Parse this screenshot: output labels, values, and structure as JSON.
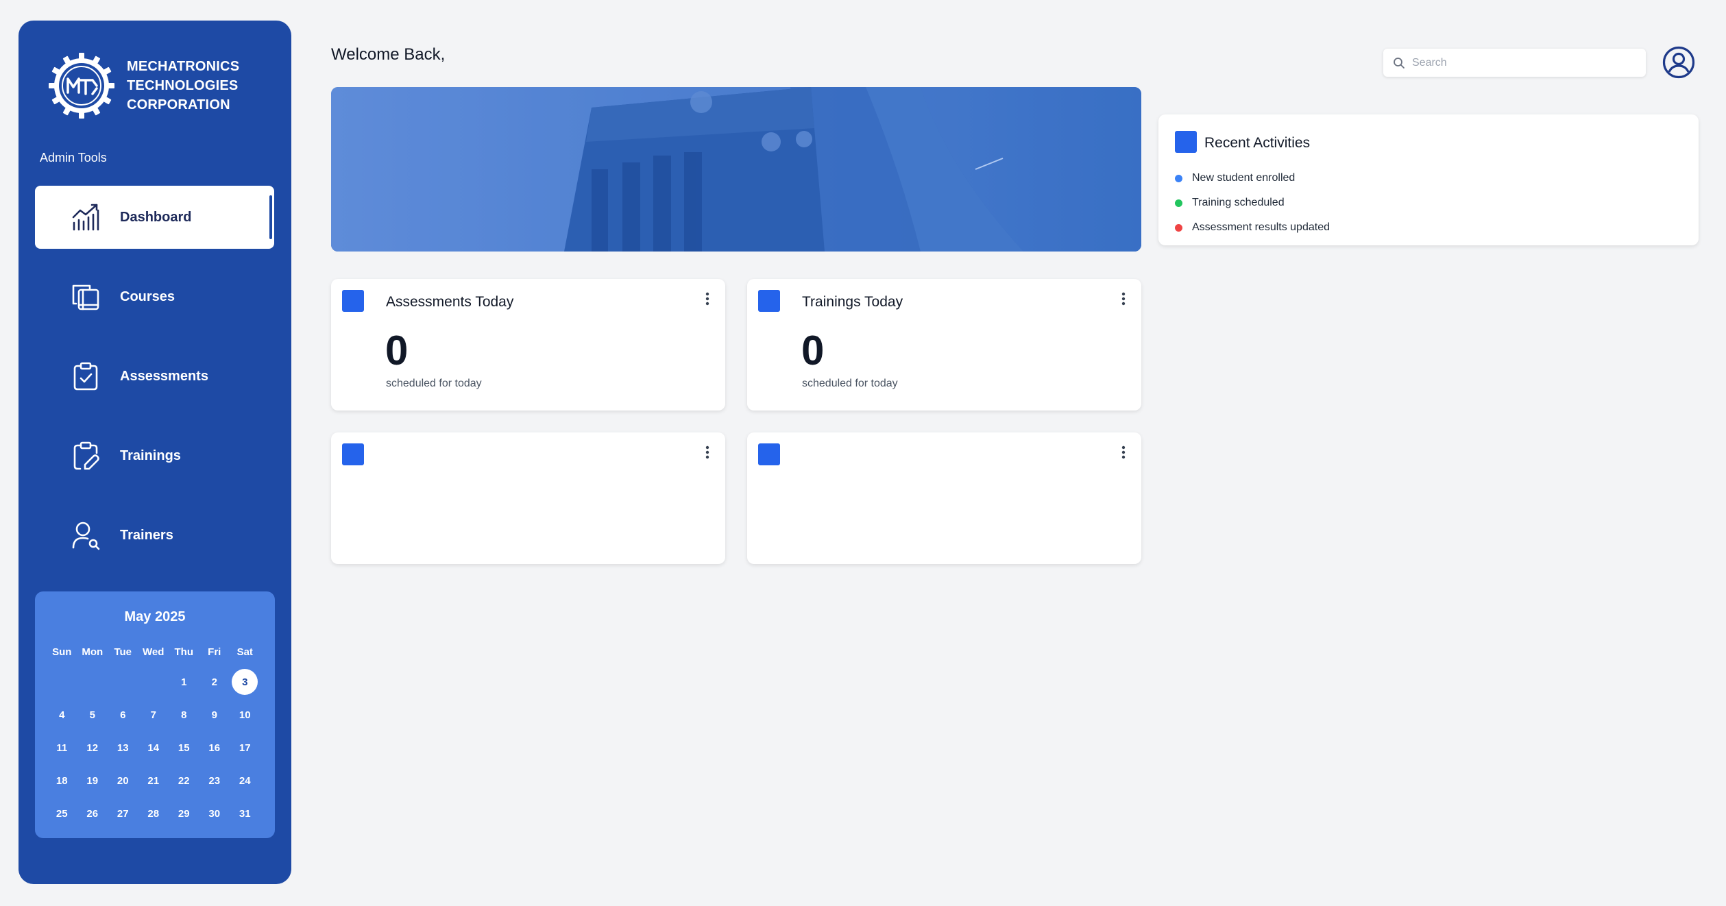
{
  "brand": {
    "line1": "MECHATRONICS",
    "line2": "TECHNOLOGIES",
    "line3": "CORPORATION",
    "logo_text": "MTC"
  },
  "sidebar": {
    "section_label": "Admin Tools",
    "items": [
      {
        "label": "Dashboard",
        "icon": "chart-icon",
        "active": true
      },
      {
        "label": "Courses",
        "icon": "book-copy-icon",
        "active": false
      },
      {
        "label": "Assessments",
        "icon": "clipboard-check-icon",
        "active": false
      },
      {
        "label": "Trainings",
        "icon": "clipboard-pen-icon",
        "active": false
      },
      {
        "label": "Trainers",
        "icon": "user-search-icon",
        "active": false
      }
    ]
  },
  "calendar": {
    "title": "May 2025",
    "weekdays": [
      "Sun",
      "Mon",
      "Tue",
      "Wed",
      "Thu",
      "Fri",
      "Sat"
    ],
    "weeks": [
      [
        "",
        "",
        "",
        "",
        "1",
        "2",
        "3"
      ],
      [
        "4",
        "5",
        "6",
        "7",
        "8",
        "9",
        "10"
      ],
      [
        "11",
        "12",
        "13",
        "14",
        "15",
        "16",
        "17"
      ],
      [
        "18",
        "19",
        "20",
        "21",
        "22",
        "23",
        "24"
      ],
      [
        "25",
        "26",
        "27",
        "28",
        "29",
        "30",
        "31"
      ]
    ],
    "today": "3"
  },
  "header": {
    "welcome": "Welcome Back,",
    "search_placeholder": "Search"
  },
  "cards": {
    "assessments": {
      "title": "Assessments Today",
      "value": "0",
      "subtitle": "scheduled for today"
    },
    "trainings": {
      "title": "Trainings Today",
      "value": "0",
      "subtitle": "scheduled for today"
    }
  },
  "recent": {
    "title": "Recent Activities",
    "items": [
      {
        "text": "New student enrolled",
        "color": "#3b82f6"
      },
      {
        "text": "Training scheduled",
        "color": "#22c55e"
      },
      {
        "text": "Assessment results updated",
        "color": "#ef4444"
      }
    ]
  },
  "colors": {
    "sidebar": "#1e4aa5",
    "accent": "#2563eb",
    "calendar": "#4a7fe0",
    "background": "#f3f4f6"
  }
}
